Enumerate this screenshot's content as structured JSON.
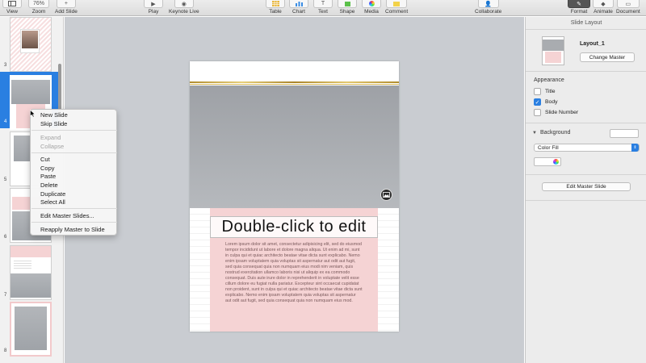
{
  "toolbar": {
    "left": [
      {
        "id": "view",
        "label": "View",
        "icon": "sidebar-icon"
      },
      {
        "id": "zoom",
        "label": "Zoom",
        "value": "76%"
      },
      {
        "id": "add_slide",
        "label": "Add Slide",
        "icon": "plus-icon"
      }
    ],
    "play": [
      {
        "id": "play",
        "label": "Play",
        "icon": "play-icon"
      },
      {
        "id": "keynote_live",
        "label": "Keynote Live",
        "icon": "broadcast-icon"
      }
    ],
    "insert": [
      {
        "id": "table",
        "label": "Table",
        "icon": "table-icon"
      },
      {
        "id": "chart",
        "label": "Chart",
        "icon": "chart-icon"
      },
      {
        "id": "text",
        "label": "Text",
        "icon": "text-icon"
      },
      {
        "id": "shape",
        "label": "Shape",
        "icon": "shape-icon"
      },
      {
        "id": "media",
        "label": "Media",
        "icon": "media-icon"
      },
      {
        "id": "comment",
        "label": "Comment",
        "icon": "comment-icon"
      }
    ],
    "collaborate": {
      "label": "Collaborate",
      "icon": "collaborate-icon"
    },
    "right": [
      {
        "id": "format",
        "label": "Format",
        "icon": "paintbrush-icon",
        "active": true
      },
      {
        "id": "animate",
        "label": "Animate",
        "icon": "diamond-icon"
      },
      {
        "id": "document",
        "label": "Document",
        "icon": "document-icon"
      }
    ]
  },
  "navigator": {
    "slide_numbers": [
      "3",
      "4",
      "5",
      "6",
      "7",
      "8"
    ],
    "selected": "4"
  },
  "context_menu": {
    "items": [
      {
        "label": "New Slide",
        "enabled": true
      },
      {
        "label": "Skip Slide",
        "enabled": true
      },
      {
        "label": "Expand",
        "enabled": false
      },
      {
        "label": "Collapse",
        "enabled": false
      },
      {
        "label": "Cut",
        "enabled": true
      },
      {
        "label": "Copy",
        "enabled": true
      },
      {
        "label": "Paste",
        "enabled": true
      },
      {
        "label": "Delete",
        "enabled": true
      },
      {
        "label": "Duplicate",
        "enabled": true
      },
      {
        "label": "Select All",
        "enabled": true
      },
      {
        "label": "Edit Master Slides...",
        "enabled": true
      },
      {
        "label": "Reapply Master to Slide",
        "enabled": true
      }
    ]
  },
  "slide": {
    "title": "Double-click to edit",
    "body": "Lorem ipsum dolor sit amet, consectetur adipisicing elit, sed do eiusmod tempor incididunt ut labore et dolore magna aliqua. Ut enim ad mi, sunt in culpa qui et quiac architecto beatae vitae dicta sunt explicabo. Nemo enim ipsam voluptatem quia voluptas sit aspernatur aut odit aut fugit, sed quia consequat quia non numquam eius modi nim veniam, quis nostrud exercitation ullamco laboris nisi ut aliquip ex ea commodo consequat. Duis aute irure dolor in reprehenderit in voluptate velit esse cillum dolore eu fugiat nulla pariatur. Excepteur sint occaecat cupidatat non proident, sunt in culpa qui et quiac architecto beatae vitae dicta sunt explicabo. Nemo enim ipsam voluptatem quia voluptas sit aspernatur aut odit aut fugit, sed quia consequat quia non numquam eius mod."
  },
  "inspector": {
    "panel_title": "Slide Layout",
    "layout_name": "Layout_1",
    "change_master": "Change Master",
    "appearance_label": "Appearance",
    "checkboxes": [
      {
        "label": "Title",
        "checked": false
      },
      {
        "label": "Body",
        "checked": true
      },
      {
        "label": "Slide Number",
        "checked": false
      }
    ],
    "background_label": "Background",
    "fill_option": "Color Fill",
    "edit_master": "Edit Master Slide"
  },
  "colors": {
    "accent": "#2a7fe1",
    "slide_pink": "#f5d3d4",
    "gold": "#d4b14e",
    "canvas": "#c9ccd1"
  }
}
